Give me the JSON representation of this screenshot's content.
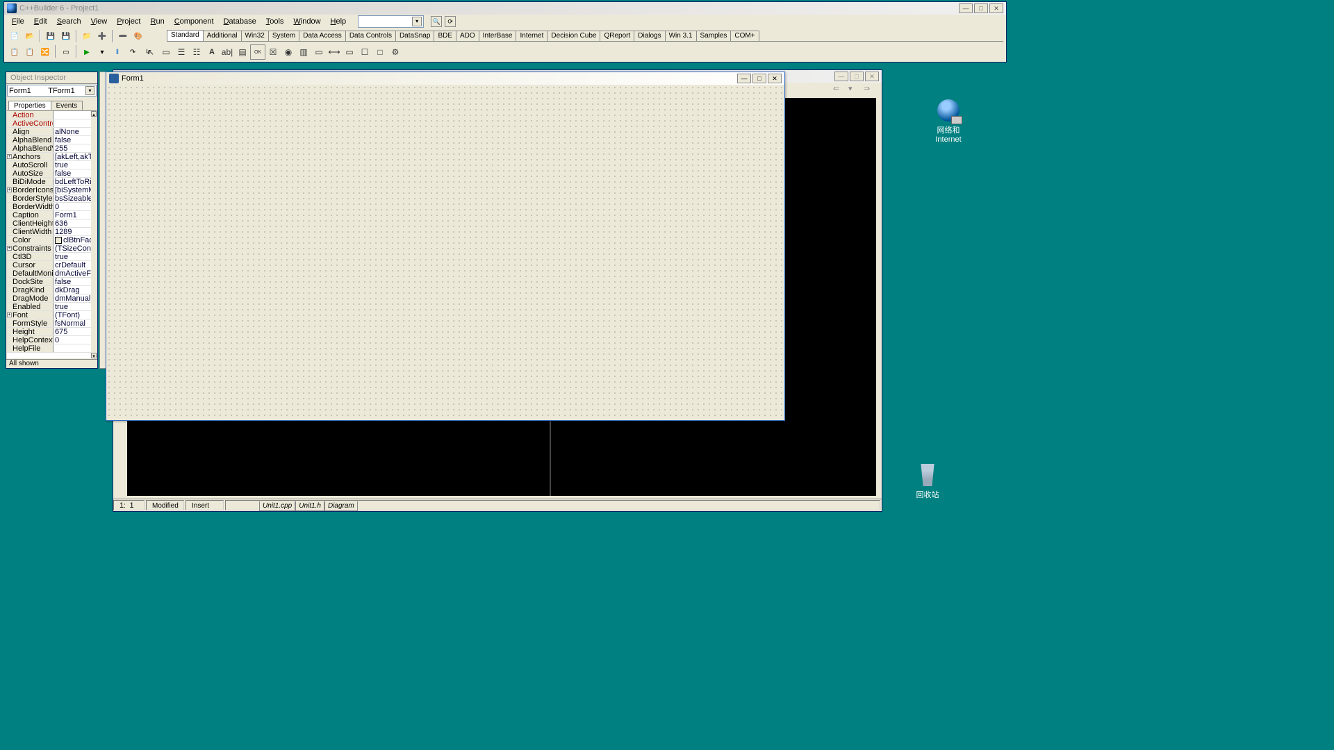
{
  "ide": {
    "title": "C++Builder 6 - Project1",
    "menus": [
      "File",
      "Edit",
      "Search",
      "View",
      "Project",
      "Run",
      "Component",
      "Database",
      "Tools",
      "Window",
      "Help"
    ],
    "combo_value": "",
    "palette_tabs": [
      "Standard",
      "Additional",
      "Win32",
      "System",
      "Data Access",
      "Data Controls",
      "DataSnap",
      "BDE",
      "ADO",
      "InterBase",
      "Internet",
      "Decision Cube",
      "QReport",
      "Dialogs",
      "Win 3.1",
      "Samples",
      "COM+"
    ],
    "active_palette": 0
  },
  "inspector": {
    "title": "Object Inspector",
    "object_name": "Form1",
    "object_type": "TForm1",
    "tabs": [
      "Properties",
      "Events"
    ],
    "active_tab": 0,
    "status": "All shown",
    "properties": [
      {
        "name": "Action",
        "value": "",
        "red": true,
        "expand": false
      },
      {
        "name": "ActiveControl",
        "value": "",
        "red": true,
        "expand": false
      },
      {
        "name": "Align",
        "value": "alNone",
        "red": false,
        "expand": false
      },
      {
        "name": "AlphaBlend",
        "value": "false",
        "red": false,
        "expand": false
      },
      {
        "name": "AlphaBlendValu",
        "value": "255",
        "red": false,
        "expand": false
      },
      {
        "name": "Anchors",
        "value": "[akLeft,akTop",
        "red": false,
        "expand": true
      },
      {
        "name": "AutoScroll",
        "value": "true",
        "red": false,
        "expand": false
      },
      {
        "name": "AutoSize",
        "value": "false",
        "red": false,
        "expand": false
      },
      {
        "name": "BiDiMode",
        "value": "bdLeftToRigh",
        "red": false,
        "expand": false
      },
      {
        "name": "BorderIcons",
        "value": "[biSystemMen",
        "red": false,
        "expand": true
      },
      {
        "name": "BorderStyle",
        "value": "bsSizeable",
        "red": false,
        "expand": false
      },
      {
        "name": "BorderWidth",
        "value": "0",
        "red": false,
        "expand": false
      },
      {
        "name": "Caption",
        "value": "Form1",
        "red": false,
        "expand": false
      },
      {
        "name": "ClientHeight",
        "value": "636",
        "red": false,
        "expand": false
      },
      {
        "name": "ClientWidth",
        "value": "1289",
        "red": false,
        "expand": false
      },
      {
        "name": "Color",
        "value": "clBtnFace",
        "red": false,
        "expand": false,
        "colorbox": true
      },
      {
        "name": "Constraints",
        "value": "(TSizeConstra",
        "red": false,
        "expand": true
      },
      {
        "name": "Ctl3D",
        "value": "true",
        "red": false,
        "expand": false
      },
      {
        "name": "Cursor",
        "value": "crDefault",
        "red": false,
        "expand": false
      },
      {
        "name": "DefaultMonitor",
        "value": "dmActiveForm",
        "red": false,
        "expand": false
      },
      {
        "name": "DockSite",
        "value": "false",
        "red": false,
        "expand": false
      },
      {
        "name": "DragKind",
        "value": "dkDrag",
        "red": false,
        "expand": false
      },
      {
        "name": "DragMode",
        "value": "dmManual",
        "red": false,
        "expand": false
      },
      {
        "name": "Enabled",
        "value": "true",
        "red": false,
        "expand": false
      },
      {
        "name": "Font",
        "value": "(TFont)",
        "red": false,
        "expand": true
      },
      {
        "name": "FormStyle",
        "value": "fsNormal",
        "red": false,
        "expand": false
      },
      {
        "name": "Height",
        "value": "675",
        "red": false,
        "expand": false
      },
      {
        "name": "HelpContext",
        "value": "0",
        "red": false,
        "expand": false
      },
      {
        "name": "HelpFile",
        "value": "",
        "red": false,
        "expand": false
      }
    ]
  },
  "form_designer": {
    "title": "Form1"
  },
  "code_window": {
    "status_line": "1",
    "status_col": "1",
    "status_mod": "Modified",
    "status_ins": "Insert",
    "tabs": [
      "Unit1.cpp",
      "Unit1.h",
      "Diagram"
    ]
  },
  "desktop": {
    "net_label1": "网络和",
    "net_label2": "Internet",
    "recycle_label": "回收站"
  }
}
